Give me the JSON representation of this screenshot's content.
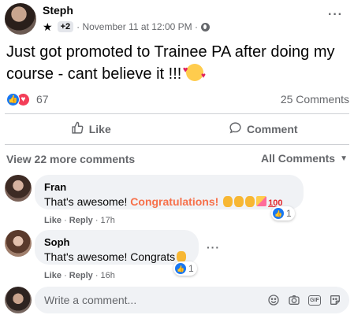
{
  "post": {
    "author": "Steph",
    "badge_count": "+2",
    "timestamp": "· November 11 at 12:00 PM ·",
    "text": "Just got promoted to Trainee PA after doing my course - cant believe it !!!",
    "reaction_count": "67",
    "comment_count": "25 Comments"
  },
  "actions": {
    "like_label": "Like",
    "comment_label": "Comment"
  },
  "comments_section": {
    "view_more": "View 22 more comments",
    "filter_label": "All Comments"
  },
  "comments": [
    {
      "name": "Fran",
      "text_before": "That's awesome! ",
      "text_highlight": "Congratulations!",
      "reaction_count": "1",
      "like": "Like",
      "reply": "Reply",
      "time": "· 17h"
    },
    {
      "name": "Soph",
      "text_before": "That's awesome! Congrats",
      "reaction_count": "1",
      "like": "Like",
      "reply": "Reply",
      "time": "· 16h"
    }
  ],
  "composer": {
    "placeholder": "Write a comment..."
  },
  "icons": {
    "more": "more-icon",
    "star": "star-icon",
    "globe": "globe-icon",
    "like": "thumbs-up-icon",
    "comment": "speech-bubble-icon",
    "emoji": "smiley-icon",
    "camera": "camera-icon",
    "gif": "gif-icon",
    "sticker": "sticker-icon"
  },
  "colors": {
    "like_blue": "#1877f2",
    "love_red": "#f33e58",
    "congrats_orange": "#f7704a",
    "muted_text": "#65676b",
    "bubble_bg": "#f0f2f5"
  }
}
